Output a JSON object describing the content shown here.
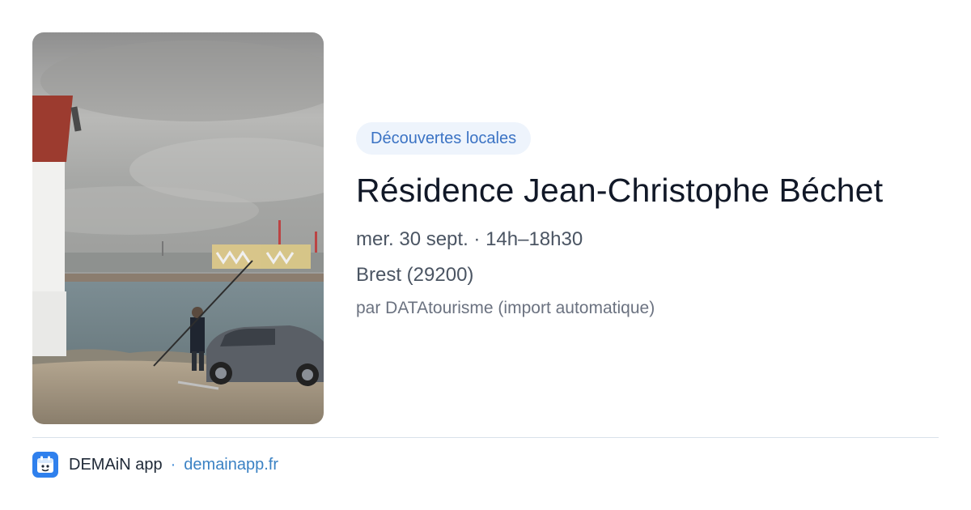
{
  "event": {
    "category": "Découvertes locales",
    "title": "Résidence Jean-Christophe Béchet",
    "datetime": "mer. 30 sept. · 14h–18h30",
    "location": "Brest (29200)",
    "author": "par DATAtourisme (import automatique)"
  },
  "footer": {
    "app_name": "DEMAiN app",
    "separator": "·",
    "url": "demainapp.fr"
  },
  "colors": {
    "chip_bg": "#eef4fc",
    "chip_text": "#3b73c4",
    "link": "#3b82c4",
    "app_icon": "#2f80ed"
  },
  "icons": {
    "app": "calendar-app-icon"
  }
}
